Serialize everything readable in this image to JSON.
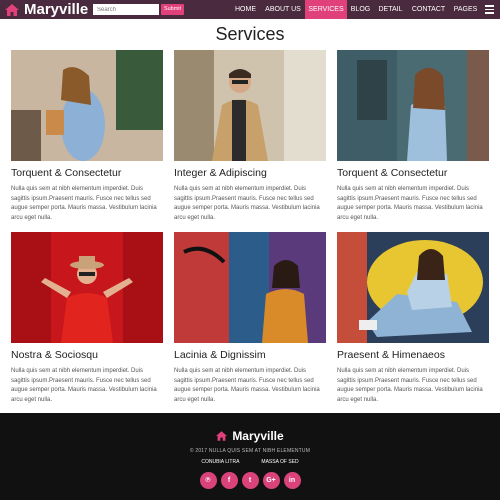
{
  "colors": {
    "header_bg": "#4a2a3e",
    "accent": "#e0417a",
    "footer_bg": "#111111"
  },
  "header": {
    "brand": "Maryville",
    "search_placeholder": "Search",
    "search_button": "Submit",
    "nav": [
      "HOME",
      "ABOUT US",
      "SERVICES",
      "BLOG",
      "DETAIL",
      "CONTACT",
      "PAGES"
    ],
    "active_nav": "SERVICES"
  },
  "page": {
    "title": "Services"
  },
  "cards": [
    {
      "title": "Torquent & Consectetur",
      "text": "Nulla quis sem at nibh elementum imperdiet. Duis sagittis ipsum.Praesent mauris. Fusce nec tellus sed augue semper porta. Mauris massa. Vestibulum lacinia arcu eget nulla."
    },
    {
      "title": "Integer & Adipiscing",
      "text": "Nulla quis sem at nibh elementum imperdiet. Duis sagittis ipsum.Praesent mauris. Fusce nec tellus sed augue semper porta. Mauris massa. Vestibulum lacinia arcu eget nulla."
    },
    {
      "title": "Torquent & Consectetur",
      "text": "Nulla quis sem at nibh elementum imperdiet. Duis sagittis ipsum.Praesent mauris. Fusce nec tellus sed augue semper porta. Mauris massa. Vestibulum lacinia arcu eget nulla."
    },
    {
      "title": "Nostra & Sociosqu",
      "text": "Nulla quis sem at nibh elementum imperdiet. Duis sagittis ipsum.Praesent mauris. Fusce nec tellus sed augue semper porta. Mauris massa. Vestibulum lacinia arcu eget nulla."
    },
    {
      "title": "Lacinia & Dignissim",
      "text": "Nulla quis sem at nibh elementum imperdiet. Duis sagittis ipsum.Praesent mauris. Fusce nec tellus sed augue semper porta. Mauris massa. Vestibulum lacinia arcu eget nulla."
    },
    {
      "title": "Praesent & Himenaeos",
      "text": "Nulla quis sem at nibh elementum imperdiet. Duis sagittis ipsum.Praesent mauris. Fusce nec tellus sed augue semper porta. Mauris massa. Vestibulum lacinia arcu eget nulla."
    }
  ],
  "footer": {
    "brand": "Maryville",
    "copyright": "© 2017 NULLA QUIS SEM AT NIBH ELEMENTUM",
    "links": [
      "CONUBIA LITRA",
      "MASSA OF SED"
    ],
    "socials": [
      {
        "icon": "pinterest-icon",
        "glyph": "℗"
      },
      {
        "icon": "facebook-icon",
        "glyph": "f"
      },
      {
        "icon": "twitter-icon",
        "glyph": "t"
      },
      {
        "icon": "google-plus-icon",
        "glyph": "G+"
      },
      {
        "icon": "linkedin-icon",
        "glyph": "in"
      }
    ]
  }
}
